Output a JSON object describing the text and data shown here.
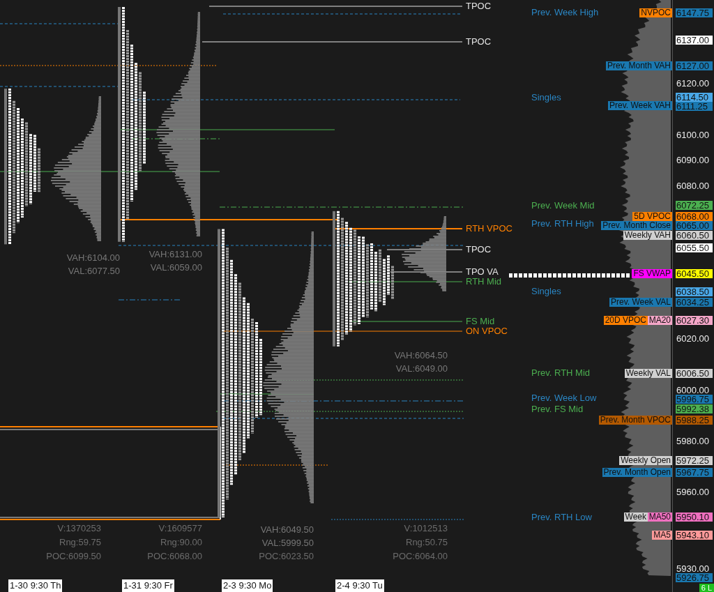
{
  "levels": [
    {
      "price": {
        "text": "6147.75",
        "color": "#1a78b0"
      },
      "tags": [
        {
          "text": "NVPOC",
          "color": "#ff8000"
        }
      ],
      "label": {
        "text": "Prev. Week High",
        "color": "#2a86c4"
      }
    },
    {
      "price": {
        "text": "6137.00",
        "color": "#ffffff"
      }
    },
    {
      "price": {
        "text": "6127.00",
        "color": "#1a78b0"
      },
      "tags": [
        {
          "text": "Prev. Month VAH",
          "color": "#1a78b0"
        }
      ]
    },
    {
      "price": {
        "text": "6114.50",
        "color": "#4aa8e8"
      },
      "label": {
        "text": "Singles",
        "color": "#2a86c4"
      }
    },
    {
      "price": {
        "text": "6111.25",
        "color": "#1a78b0"
      },
      "tags": [
        {
          "text": "Prev. Week VAH",
          "color": "#1a78b0"
        }
      ]
    },
    {
      "price": {
        "text": "6072.25",
        "color": "#4caf50"
      },
      "label": {
        "text": "Prev. Week Mid",
        "color": "#4caf50"
      }
    },
    {
      "price": {
        "text": "6068.00",
        "color": "#ff8000"
      },
      "tags": [
        {
          "text": "5D VPOC",
          "color": "#ff8000"
        }
      ]
    },
    {
      "price": {
        "text": "6065.00",
        "color": "#1a78b0"
      },
      "tags": [
        {
          "text": "Prev. Month Close",
          "color": "#1a78b0"
        }
      ],
      "label": {
        "text": "Prev. RTH High",
        "color": "#2a86c4"
      }
    },
    {
      "price": {
        "text": "6060.50",
        "color": "#d0d0d0"
      },
      "tags": [
        {
          "text": "Weekly VAH",
          "color": "#d0d0d0"
        }
      ]
    },
    {
      "price": {
        "text": "6055.50",
        "color": "#ffffff"
      }
    },
    {
      "price": {
        "text": "6045.50",
        "color": "#ffff00"
      },
      "tags": [
        {
          "text": "FS VWAP",
          "color": "#ff00ff"
        }
      ]
    },
    {
      "price": {
        "text": "6038.50",
        "color": "#4aa8e8"
      },
      "label": {
        "text": "Singles",
        "color": "#2a86c4"
      }
    },
    {
      "price": {
        "text": "6034.25",
        "color": "#1a78b0"
      },
      "tags": [
        {
          "text": "Prev. Week VAL",
          "color": "#1a78b0"
        }
      ]
    },
    {
      "price": {
        "text": "6027.30",
        "color": "#f4a6c8"
      },
      "tags": [
        {
          "text": "20D VPOC",
          "color": "#ff8000"
        },
        {
          "text": "MA20",
          "color": "#f4a6c8"
        }
      ]
    },
    {
      "price": {
        "text": "6006.50",
        "color": "#d0d0d0"
      },
      "tags": [
        {
          "text": "Weekly VAL",
          "color": "#d0d0d0"
        }
      ],
      "label": {
        "text": "Prev. RTH Mid",
        "color": "#4caf50"
      }
    },
    {
      "price": {
        "text": "5996.75",
        "color": "#1a78b0"
      },
      "label": {
        "text": "Prev. Week Low",
        "color": "#2a86c4"
      }
    },
    {
      "price": {
        "text": "5992.38",
        "color": "#4caf50"
      },
      "label": {
        "text": "Prev. FS Mid",
        "color": "#4caf50"
      }
    },
    {
      "price": {
        "text": "5988.25",
        "color": "#b35900"
      },
      "tags": [
        {
          "text": "Prev. Month VPOC",
          "color": "#b35900"
        }
      ]
    },
    {
      "price": {
        "text": "5972.25",
        "color": "#d0d0d0"
      },
      "tags": [
        {
          "text": "Weekly Open",
          "color": "#d0d0d0"
        }
      ]
    },
    {
      "price": {
        "text": "5967.75",
        "color": "#1a78b0"
      },
      "tags": [
        {
          "text": "Prev. Month Open",
          "color": "#1a78b0"
        }
      ]
    },
    {
      "price": {
        "text": "5950.10",
        "color": "#f070c0"
      },
      "tags": [
        {
          "text": "Week",
          "color": "#d0d0d0"
        },
        {
          "text": "MA50",
          "color": "#f070c0"
        }
      ],
      "label": {
        "text": "Prev. RTH Low",
        "color": "#2a86c4"
      }
    },
    {
      "price": {
        "text": "5943.10",
        "color": "#ff9a9a"
      },
      "tags": [
        {
          "text": "MA5",
          "color": "#ff9a9a"
        }
      ]
    },
    {
      "price": {
        "text": "5926.75",
        "color": "#1a78b0"
      }
    }
  ],
  "price_axis": {
    "ticks": [
      "6120.00",
      "6100.00",
      "6090.00",
      "6080.00",
      "6020.00",
      "6000.00",
      "5980.00",
      "5960.00",
      "5930.00"
    ],
    "status_badge": "6 L"
  },
  "line_labels": [
    {
      "text": "TPOC",
      "color": "#e6e6e6"
    },
    {
      "text": "TPOC",
      "color": "#e6e6e6"
    },
    {
      "text": "RTH VPOC",
      "color": "#ff8000"
    },
    {
      "text": "TPOC",
      "color": "#e6e6e6"
    },
    {
      "text": "TPO VA",
      "color": "#e6e6e6"
    },
    {
      "text": "RTH Mid",
      "color": "#4caf50"
    },
    {
      "text": "FS Mid",
      "color": "#4caf50"
    },
    {
      "text": "ON VPOC",
      "color": "#ff8000"
    }
  ],
  "sessions": [
    {
      "time": "1-30  9:30 Th",
      "value_area": [
        "VAH:6104.00",
        "VAL:6077.50"
      ],
      "stats": [
        "V:1370253",
        "Rng:59.75",
        "POC:6099.50"
      ]
    },
    {
      "time": "1-31  9:30 Fr",
      "value_area": [
        "VAH:6131.00",
        "VAL:6059.00"
      ],
      "stats": [
        "V:1609577",
        "Rng:90.00",
        "POC:6068.00"
      ]
    },
    {
      "time": "2-3  9:30 Mo",
      "value_area": [
        "VAH:6049.50",
        "VAL:5999.50"
      ],
      "stats": [
        "POC:6023.50"
      ]
    },
    {
      "time": "2-4  9:30 Tu",
      "value_area": [
        "VAH:6064.50",
        "VAL:6049.00"
      ],
      "stats": [
        "V:1012513",
        "Rng:50.75",
        "POC:6064.00"
      ]
    }
  ]
}
